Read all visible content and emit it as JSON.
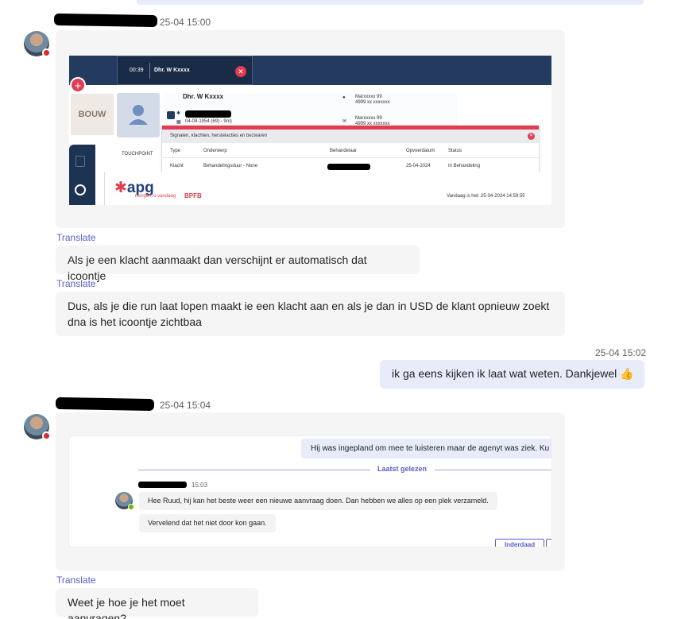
{
  "thread": {
    "msg1": {
      "timestamp": "25-04 15:00",
      "embedded": {
        "call_timer": "00:39",
        "call_name": "Dhr. W Kxxxx",
        "logo_text": "BOUW",
        "customer_name": "Dhr. W Kxxxx",
        "birth": "04-08-1954 (69) - 9m)",
        "address1_line1": "Marxxxxx 99",
        "address1_line2": "4999 xx xxxxxxx",
        "address2_line1": "Marxxxxx 99",
        "address2_line2": "4999 xx xxxxxxx",
        "modal_title": "Signalen, klachten, herstelacties en bezwaren",
        "columns": [
          "Type",
          "Onderwerp",
          "Behandelaar",
          "Opvoerdatum",
          "Status"
        ],
        "row": {
          "type": "Klacht",
          "subject": "Behandelingsduur - None",
          "date": "25-04-2024",
          "status": "In Behandeling"
        },
        "touchpoint": "TOUCHPOINT",
        "apg_text": "apg",
        "apg_slogan": "morgen is vandaag",
        "bpfb": "BPFB",
        "today_text": "Vandaag is het: 25-04-2024 14:59:55"
      },
      "translate1": "Translate",
      "text1": "Als je een klacht aanmaakt dan verschijnt er automatisch dat icoontje",
      "translate2": "Translate",
      "text2_line1": "Dus, als je die run laat lopen maakt ie een klacht aan en als je dan in USD de klant opnieuw zoekt",
      "text2_line2": "dna is het icoontje zichtbaa"
    },
    "own": {
      "timestamp": "25-04 15:02",
      "text": "ik ga eens kijken ik laat wat weten. Dankjewel",
      "emoji": "👍"
    },
    "msg2": {
      "timestamp": "25-04 15:04",
      "embedded": {
        "outgoing": "Hij was ingepland om mee te luisteren maar de agenyt was ziek. Ku",
        "last_read": "Laatst gelezen",
        "time": "15:03",
        "message1": "Hee Ruud, hij kan het beste weer een nieuwe aanvraag doen. Dan hebben we alles op een plek verzameld.",
        "message2": "Vervelend dat het niet door kon gaan.",
        "button": "Inderdaad"
      },
      "translate": "Translate",
      "text": "Weet je hoe je het moet aanvragen?"
    }
  },
  "colors": {
    "accent": "#5b5fc7",
    "bubble_other": "#f5f5f5",
    "bubble_own": "#e8ebfa",
    "status_busy": "#d92c2c",
    "crm_navy": "#243a5e",
    "crm_red": "#e23b52"
  }
}
